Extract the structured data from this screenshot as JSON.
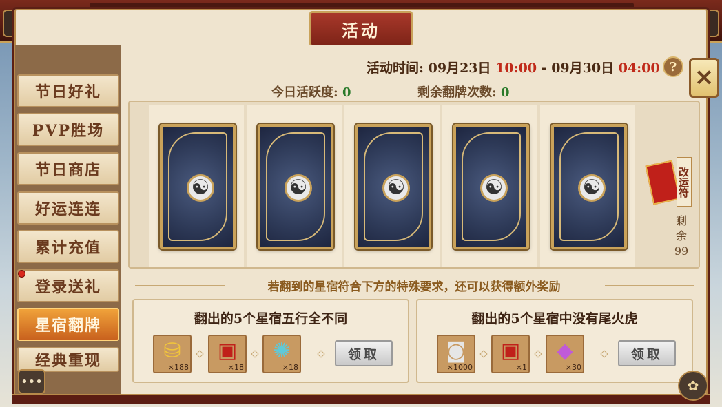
{
  "header": {
    "title": "活动"
  },
  "sidebar": {
    "items": [
      {
        "label": "节日好礼"
      },
      {
        "label": "PVP胜场"
      },
      {
        "label": "节日商店"
      },
      {
        "label": "好运连连"
      },
      {
        "label": "累计充值"
      },
      {
        "label": "登录送礼"
      },
      {
        "label": "星宿翻牌",
        "active": true
      },
      {
        "label": "经典重现"
      }
    ]
  },
  "time": {
    "prefix": "活动时间:",
    "start_date": "09月23日",
    "start_time": "10:00",
    "sep": "-",
    "end_date": "09月30日",
    "end_time": "04:00"
  },
  "stats": {
    "activity_label": "今日活跃度:",
    "activity_value": "0",
    "flips_label": "剩余翻牌次数:",
    "flips_value": "0"
  },
  "luck_charm": {
    "label": "改运符",
    "remain_label": "剩余",
    "remain_value": "99"
  },
  "hint": "若翻到的星宿符合下方的特殊要求，还可以获得额外奖励",
  "rewards": [
    {
      "title": "翻出的5个星宿五行全不同",
      "items": [
        {
          "icon": "gold-ingot-icon",
          "count": "×188"
        },
        {
          "icon": "red-chest-icon",
          "count": "×18"
        },
        {
          "icon": "spirit-orb-icon",
          "count": "×18"
        }
      ],
      "button": "领取"
    },
    {
      "title": "翻出的5个星宿中没有尾火虎",
      "items": [
        {
          "icon": "silver-coin-icon",
          "count": "×1000"
        },
        {
          "icon": "red-chest-icon",
          "count": "×1"
        },
        {
          "icon": "gem-pile-icon",
          "count": "×30"
        }
      ],
      "button": "领取"
    }
  ],
  "icons": {
    "help": "?",
    "close": "✕",
    "chat": "•••"
  }
}
